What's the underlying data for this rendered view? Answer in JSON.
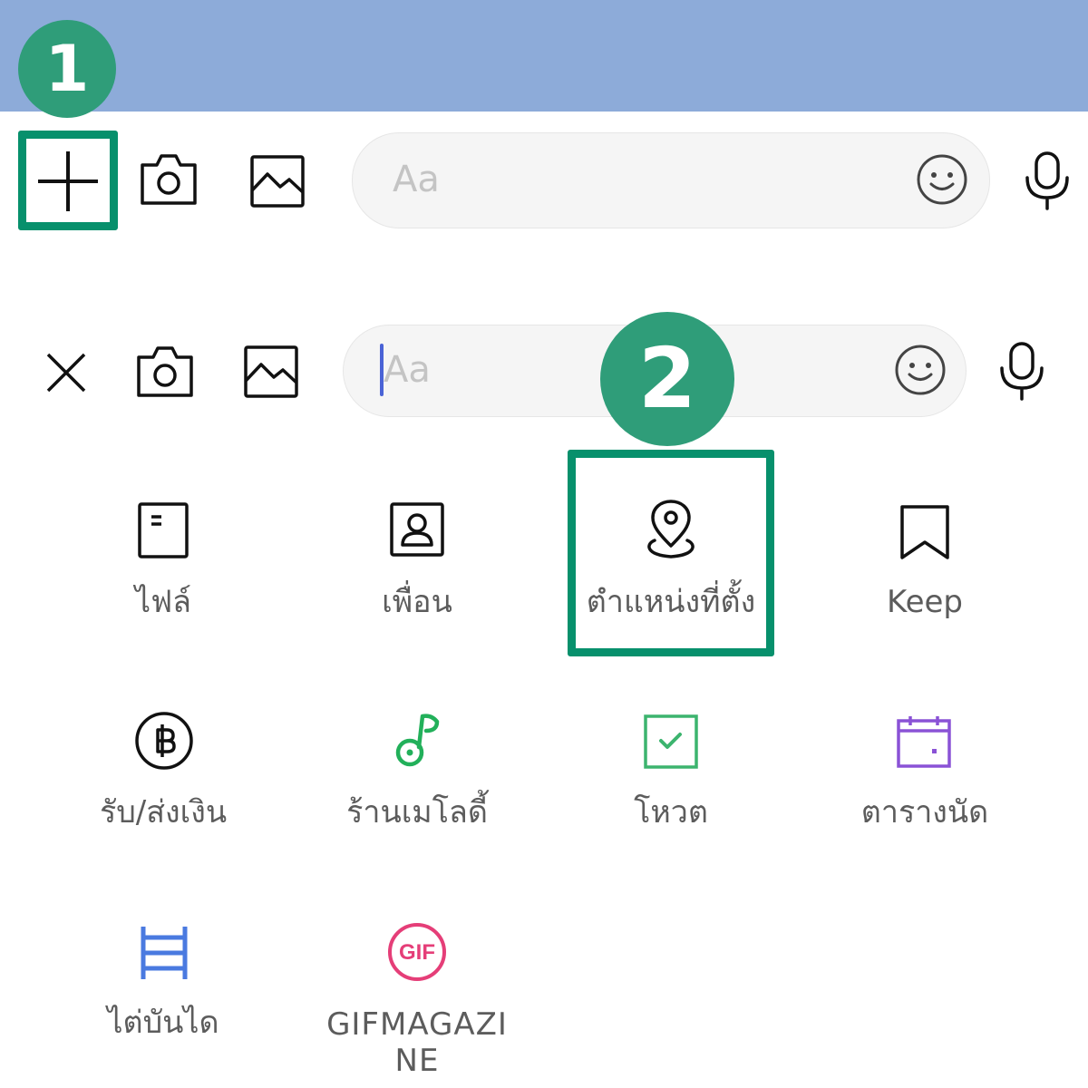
{
  "steps": {
    "step1": "1",
    "step2": "2"
  },
  "composer_top": {
    "input_placeholder": "Aa",
    "icons": [
      "plus-icon",
      "camera-icon",
      "image-icon",
      "emoji-icon",
      "microphone-icon"
    ]
  },
  "composer_open": {
    "input_placeholder": "Aa",
    "icons": [
      "close-icon",
      "camera-icon",
      "image-icon",
      "emoji-icon",
      "microphone-icon"
    ]
  },
  "menu": {
    "items": [
      {
        "label": "ไฟล์",
        "icon": "file-icon"
      },
      {
        "label": "เพื่อน",
        "icon": "contact-icon"
      },
      {
        "label": "ตำแหน่งที่ตั้ง",
        "icon": "location-pin-icon"
      },
      {
        "label": "Keep",
        "icon": "bookmark-icon"
      },
      {
        "label": "รับ/ส่งเงิน",
        "icon": "baht-coin-icon"
      },
      {
        "label": "ร้านเมโลดี้",
        "icon": "music-note-icon"
      },
      {
        "label": "โหวต",
        "icon": "vote-checkbox-icon"
      },
      {
        "label": "ตารางนัด",
        "icon": "calendar-icon"
      },
      {
        "label": "ไต่บันได",
        "icon": "ladder-icon"
      },
      {
        "label": "GIFMAGAZI NE",
        "icon": "gif-icon",
        "icon_text": "GIF"
      }
    ]
  },
  "colors": {
    "header_band": "#8dabd9",
    "highlight": "#07906c",
    "badge": "#2f9d79",
    "caret": "#4a63d6",
    "melody_green": "#22b05a",
    "vote_green": "#3cb46e",
    "calendar_purple": "#8a52d6",
    "ladder_blue": "#4a7ae0",
    "gif_pink": "#e53e78"
  }
}
